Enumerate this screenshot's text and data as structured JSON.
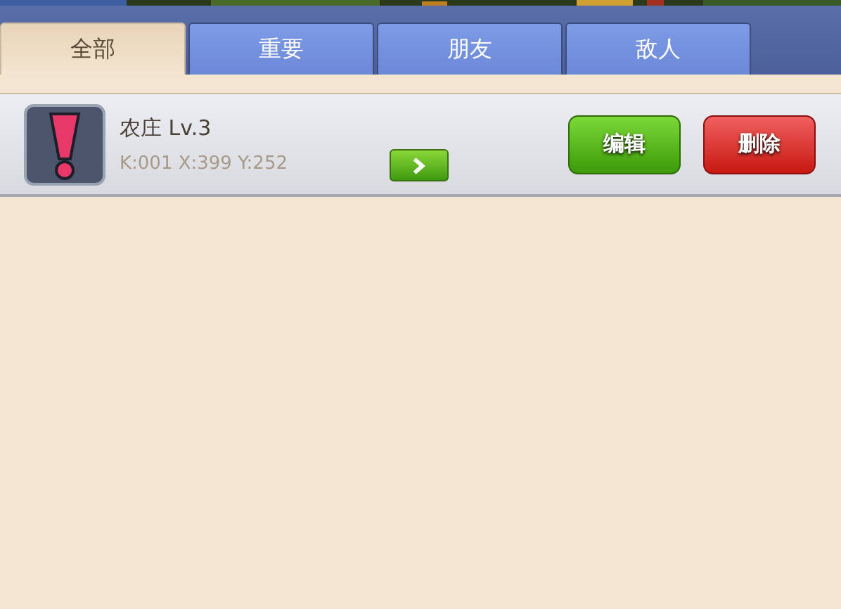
{
  "tabs": [
    {
      "label": "全部",
      "selected": true
    },
    {
      "label": "重要",
      "selected": false
    },
    {
      "label": "朋友",
      "selected": false
    },
    {
      "label": "敌人",
      "selected": false
    }
  ],
  "entries": [
    {
      "name": "农庄 Lv.3",
      "coords": "K:001 X:399 Y:252",
      "edit": "编辑",
      "delete": "删除"
    }
  ]
}
